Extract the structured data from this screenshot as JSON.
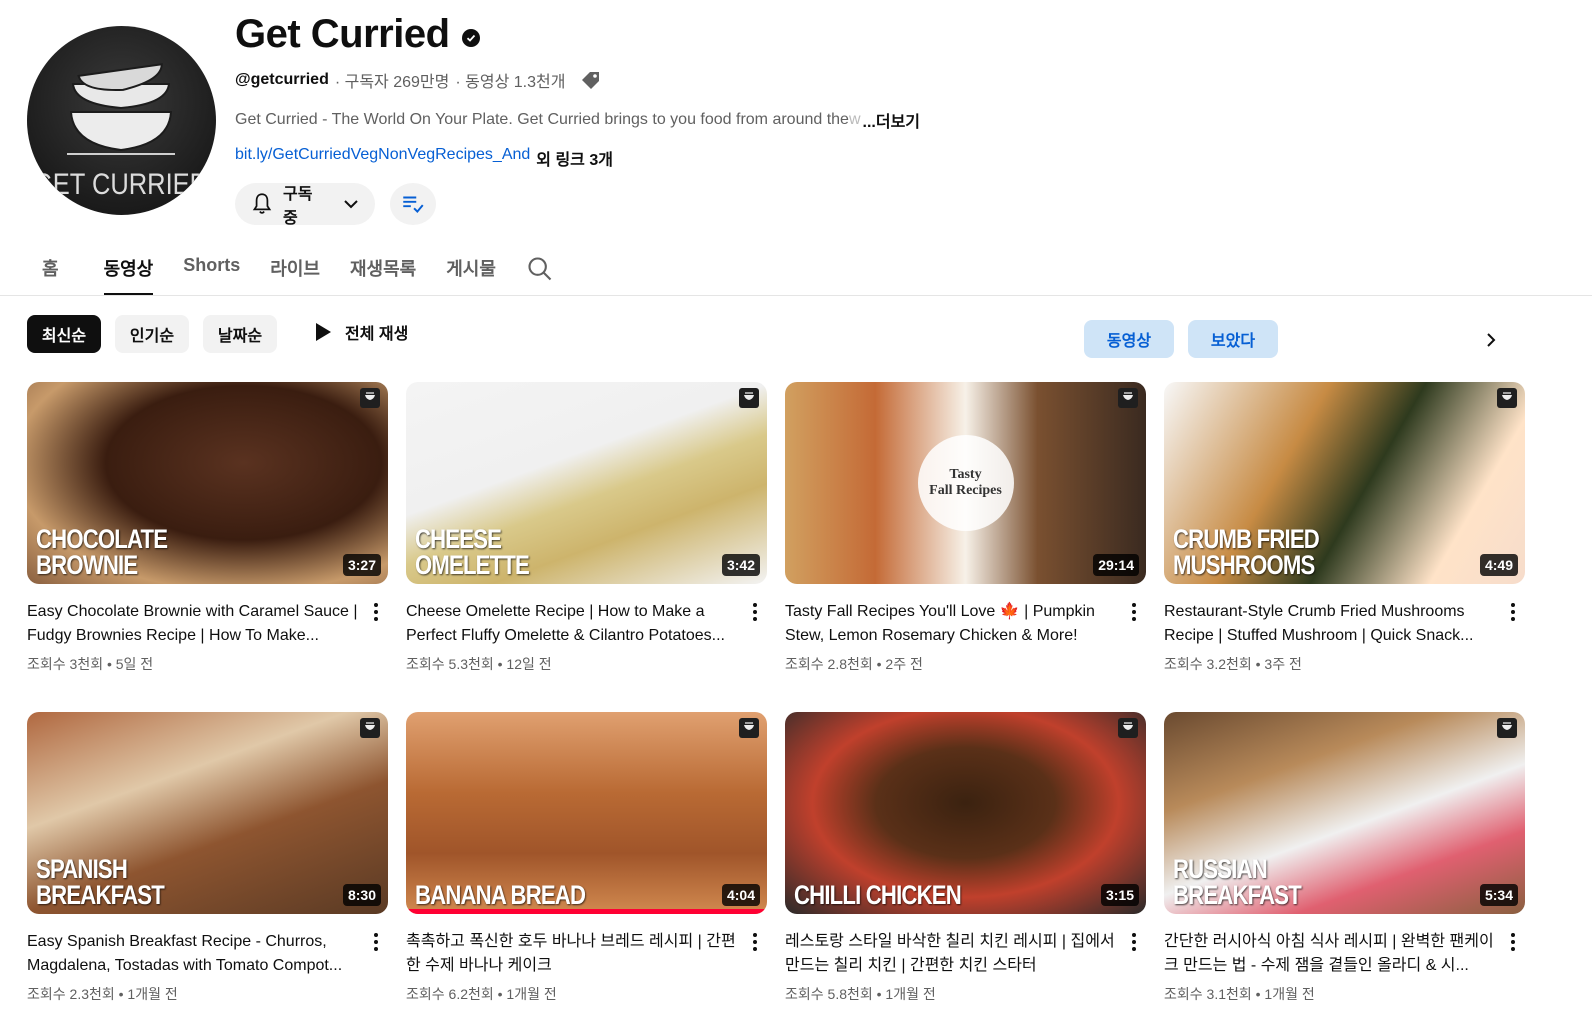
{
  "channel": {
    "name": "Get Curried",
    "handle": "@getcurried",
    "subscribers": "· 구독자 269만명",
    "video_count": "· 동영상 1.3천개",
    "description": "Get Curried  - The World On Your Plate. Get Curried brings to you food from around the ",
    "description_fade": "w",
    "more_label": "...더보기",
    "link": "bit.ly/GetCurriedVegNonVegRecipes_And",
    "link_extra": "외 링크 3개",
    "subscribe_label": "구독중",
    "avatar_text": "GET CURRIED"
  },
  "tabs": [
    {
      "label": "홈"
    },
    {
      "label": "동영상"
    },
    {
      "label": "Shorts"
    },
    {
      "label": "라이브"
    },
    {
      "label": "재생목록"
    },
    {
      "label": "게시물"
    }
  ],
  "filters": {
    "chips": [
      "최신순",
      "인기순",
      "날짜순"
    ],
    "play_all": "전체 재생",
    "pills": [
      "동영상",
      "보았다"
    ]
  },
  "videos": [
    {
      "title": "Easy Chocolate Brownie with Caramel Sauce | Fudgy Brownies Recipe | How To Make...",
      "stats": "조회수 3천회 • 5일 전",
      "duration": "3:27",
      "thumb_text": "CHOCOLATE\nBROWNIE",
      "progress": 0
    },
    {
      "title": "Cheese Omelette Recipe | How to Make a Perfect Fluffy Omelette & Cilantro Potatoes...",
      "stats": "조회수 5.3천회 • 12일 전",
      "duration": "3:42",
      "thumb_text": "CHEESE\nOMELETTE",
      "progress": 0
    },
    {
      "title": "Tasty Fall Recipes You'll Love 🍁 | Pumpkin Stew, Lemon Rosemary Chicken & More!",
      "stats": "조회수 2.8천회 • 2주 전",
      "duration": "29:14",
      "thumb_text": "",
      "center_text": "Tasty\nFall Recipes",
      "progress": 0
    },
    {
      "title": "Restaurant-Style Crumb Fried Mushrooms Recipe | Stuffed Mushroom | Quick Snack...",
      "stats": "조회수 3.2천회 • 3주 전",
      "duration": "4:49",
      "thumb_text": "CRUMB FRIED\nMUSHROOMS",
      "progress": 0
    },
    {
      "title": "Easy Spanish Breakfast Recipe - Churros, Magdalena, Tostadas with Tomato Compot...",
      "stats": "조회수 2.3천회 • 1개월 전",
      "duration": "8:30",
      "thumb_text": "SPANISH\nBREAKFAST",
      "progress": 0
    },
    {
      "title": "촉촉하고 폭신한 호두 바나나 브레드 레시피 | 간편한 수제 바나나 케이크",
      "stats": "조회수 6.2천회 • 1개월 전",
      "duration": "4:04",
      "thumb_text": "BANANA BREAD",
      "progress": 1.0
    },
    {
      "title": "레스토랑 스타일 바삭한 칠리 치킨 레시피 | 집에서 만드는 칠리 치킨 | 간편한 치킨 스타터",
      "stats": "조회수 5.8천회 • 1개월 전",
      "duration": "3:15",
      "thumb_text": "CHILLI CHICKEN",
      "progress": 0
    },
    {
      "title": "간단한 러시아식 아침 식사 레시피 | 완벽한 팬케이크 만드는 법 - 수제 잼을 곁들인 올라디 & 시...",
      "stats": "조회수 3.1천회 • 1개월 전",
      "duration": "5:34",
      "thumb_text": "RUSSIAN\nBREAKFAST",
      "progress": 0
    }
  ],
  "colors": {
    "accent_blue": "#065fd4",
    "pill_bg": "#cfe4f7",
    "progress_red": "#ff0033"
  },
  "icons": [
    "verified-icon",
    "tag-icon",
    "bell-icon",
    "chevron-down-icon",
    "playlist-check-icon",
    "search-icon",
    "play-icon",
    "chevron-right-icon",
    "kebab-menu-icon",
    "channel-logo-icon"
  ]
}
